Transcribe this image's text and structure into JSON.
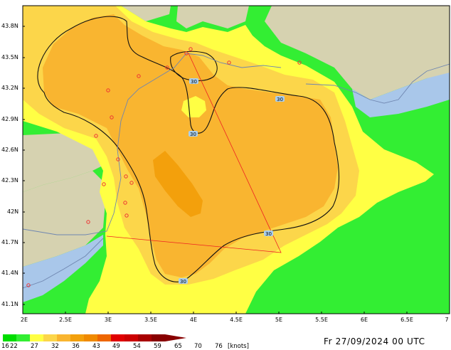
{
  "map": {
    "lat_labels": [
      "43.8N",
      "43.5N",
      "43.2N",
      "42.9N",
      "42.6N",
      "42.3N",
      "42N",
      "41.7N",
      "41.4N",
      "41.1N"
    ],
    "lon_labels": [
      "2E",
      "2.5E",
      "3E",
      "3.5E",
      "4E",
      "4.5E",
      "5E",
      "5.5E",
      "6E",
      "6.5E",
      "7"
    ],
    "contour_label": "30",
    "colors": {
      "land": "#d6d2b0",
      "sea": "#a9c7ea",
      "c16_22": "#33ee33",
      "c22_27": "#ffff44",
      "c27_32": "#fcd64a",
      "c32_36": "#f9b530",
      "c36_43": "#f3a00c",
      "route_line": "#ee2222",
      "coastline": "#6f86b0"
    }
  },
  "legend": {
    "labels": [
      "16",
      "22",
      "27",
      "32",
      "36",
      "43",
      "49",
      "54",
      "59",
      "65",
      "70",
      "76"
    ],
    "unit": "[knots]",
    "colors": [
      "#00dd00",
      "#33ee33",
      "#ffff44",
      "#fcd64a",
      "#f9b530",
      "#f3a00c",
      "#f08a00",
      "#ee6600",
      "#e00000",
      "#cc0000",
      "#a80000",
      "#880000"
    ]
  },
  "timestamp": "Fr 27/09/2024 00 UTC"
}
